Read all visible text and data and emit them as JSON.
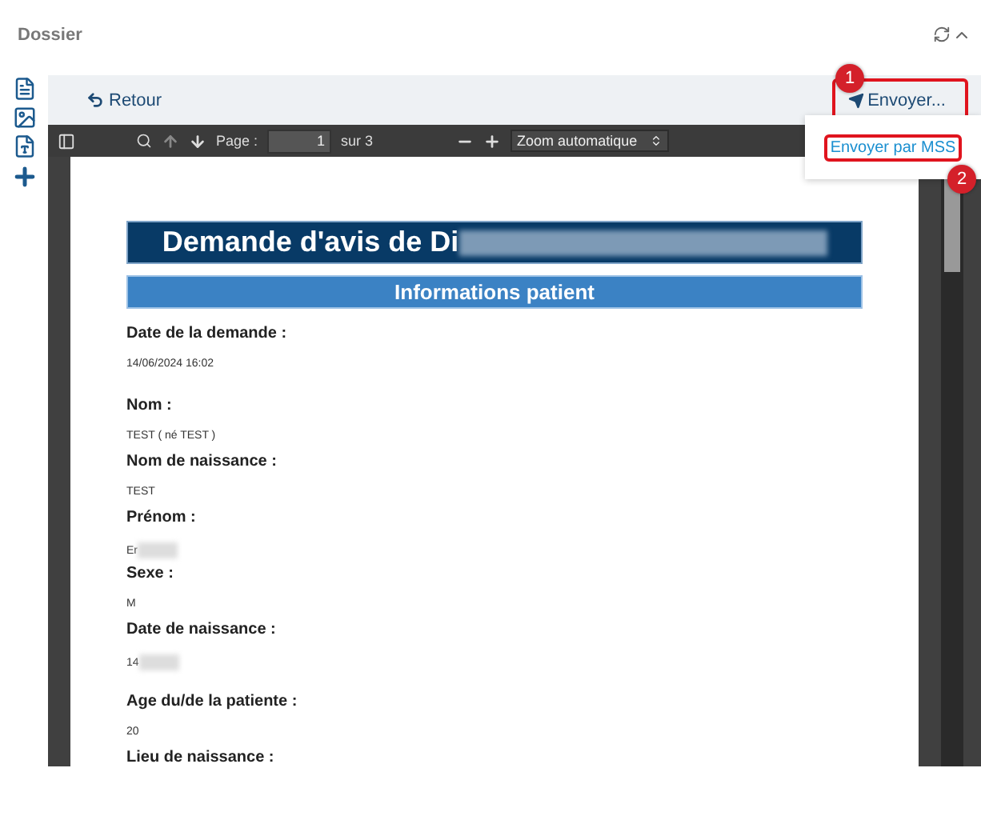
{
  "header": {
    "title": "Dossier"
  },
  "side_tools": [
    {
      "kind": "document"
    },
    {
      "kind": "image"
    },
    {
      "kind": "pdf"
    },
    {
      "kind": "add"
    }
  ],
  "action_bar": {
    "back": "Retour",
    "send": "Envoyer...",
    "send_badge": "1"
  },
  "send_menu": {
    "items": [
      {
        "label": "Envoyer par MSS",
        "badge": "2"
      }
    ]
  },
  "pdf_toolbar": {
    "page_label": "Page :",
    "page": "1",
    "total": "sur 3",
    "zoom": "Zoom automatique"
  },
  "document": {
    "title": "Demande d'avis de Di",
    "title_redacted": true,
    "section": "Informations patient",
    "groups": [
      [
        {
          "label": "Date de la demande :",
          "value": "14/06/2024 16:02",
          "redacted": false
        }
      ],
      [
        {
          "label": "Nom :",
          "value": "TEST ( né TEST )",
          "redacted": false
        },
        {
          "label": "Nom de naissance :",
          "value": "TEST",
          "redacted": false
        },
        {
          "label": "Prénom :",
          "value": "Er",
          "redacted": true
        },
        {
          "label": "Sexe :",
          "value": "M",
          "redacted": false
        },
        {
          "label": "Date de naissance :",
          "value": "14",
          "redacted": true
        }
      ],
      [
        {
          "label": "Age du/de la patiente :",
          "value": "20",
          "redacted": false
        },
        {
          "label": "Lieu de naissance :"
        }
      ]
    ]
  }
}
